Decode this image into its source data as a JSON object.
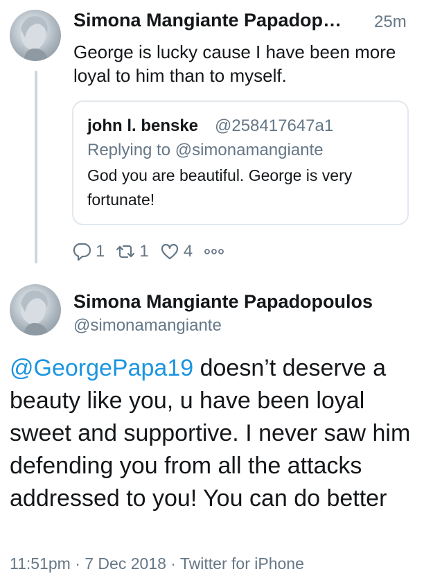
{
  "reply_tweet": {
    "author_name": "Simona Mangiante Papadop…",
    "time": "25m",
    "text": "George is lucky cause I have been more loyal to him than to myself.",
    "quoted": {
      "author_name": "john l. benske",
      "handle": "@258417647a1",
      "replying_to": "Replying to @simonamangiante",
      "text": "God you are beautiful. George is very fortunate!"
    },
    "actions": {
      "reply_icon": "reply-icon",
      "reply_count": "1",
      "retweet_icon": "retweet-icon",
      "retweet_count": "1",
      "like_icon": "heart-icon",
      "like_count": "4",
      "more_icon": "more-icon"
    }
  },
  "main_tweet": {
    "author_name": "Simona Mangiante Papadopoulos",
    "handle": "@simonamangiante",
    "mention": "@GeorgePapa19",
    "text": " doesn’t deserve a beauty like you, u have  been loyal sweet and supportive. I never saw him defending you from all the attacks addressed to you! You can do better",
    "footer": "11:51pm · 7 Dec 2018 · Twitter for iPhone"
  },
  "colors": {
    "link": "#1b95e0",
    "secondary_text": "#657786",
    "border": "#e1e8ed"
  }
}
